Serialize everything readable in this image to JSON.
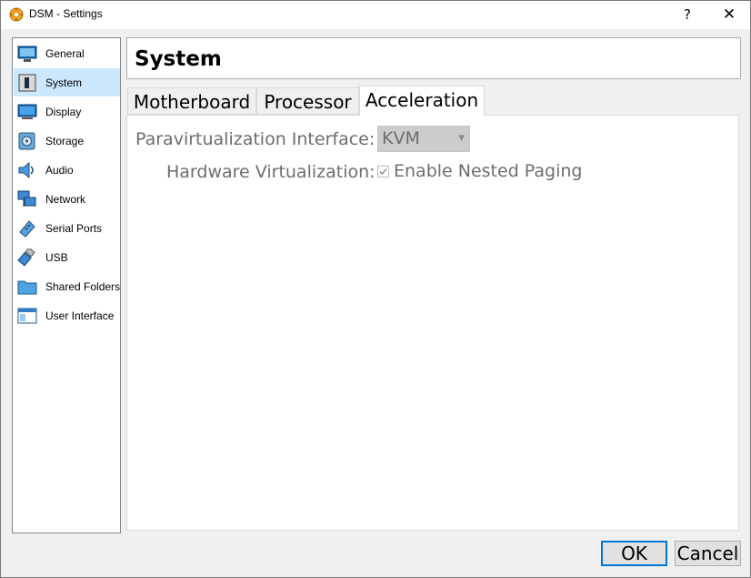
{
  "window": {
    "title": "DSM - Settings",
    "help_label": "?",
    "close_label": "✕"
  },
  "sidebar": {
    "items": [
      {
        "label": "General",
        "icon": "general-icon"
      },
      {
        "label": "System",
        "icon": "system-icon",
        "selected": true
      },
      {
        "label": "Display",
        "icon": "display-icon"
      },
      {
        "label": "Storage",
        "icon": "storage-icon"
      },
      {
        "label": "Audio",
        "icon": "audio-icon"
      },
      {
        "label": "Network",
        "icon": "network-icon"
      },
      {
        "label": "Serial Ports",
        "icon": "serial-ports-icon"
      },
      {
        "label": "USB",
        "icon": "usb-icon"
      },
      {
        "label": "Shared Folders",
        "icon": "shared-folders-icon"
      },
      {
        "label": "User Interface",
        "icon": "user-interface-icon"
      }
    ]
  },
  "header": {
    "title": "System"
  },
  "tabs": [
    {
      "label": "Motherboard"
    },
    {
      "label": "Processor"
    },
    {
      "label": "Acceleration",
      "active": true
    }
  ],
  "acceleration": {
    "paravirt_label": "Paravirtualization Interface:",
    "paravirt_value": "KVM",
    "hwvirt_label": "Hardware Virtualization:",
    "nested_paging_label": "Enable Nested Paging",
    "nested_paging_checked": true
  },
  "buttons": {
    "ok": "OK",
    "cancel": "Cancel"
  },
  "colors": {
    "selected_bg": "#cce8ff",
    "accent": "#0078d7",
    "disabled_text": "#6d6d6d"
  }
}
